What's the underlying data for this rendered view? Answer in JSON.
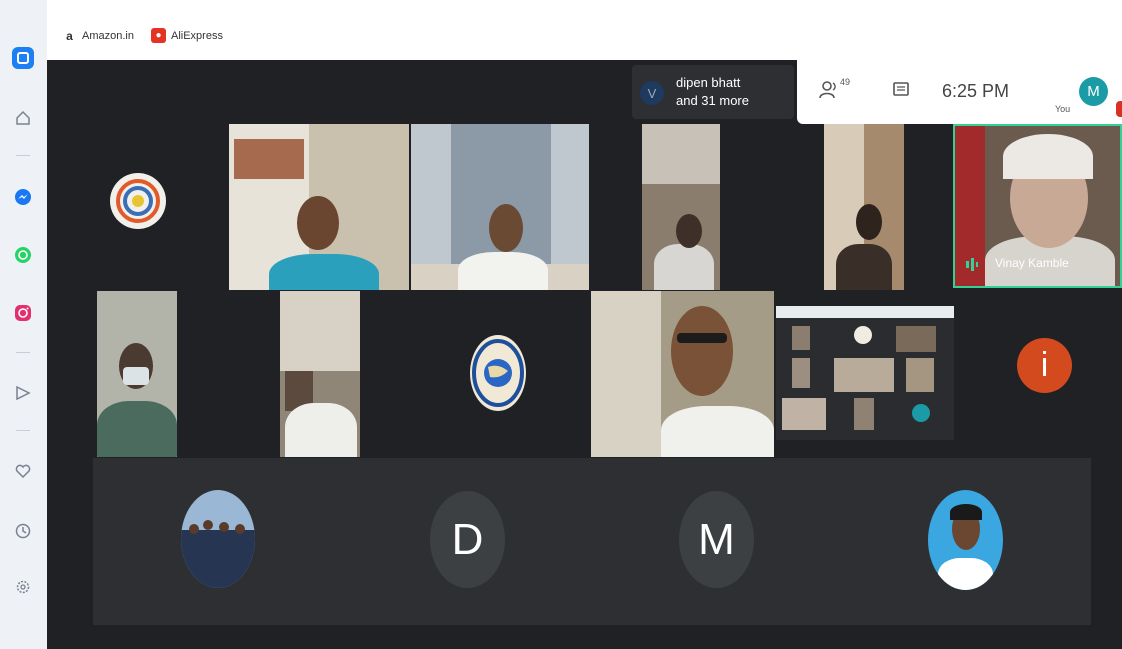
{
  "bookmarks": [
    {
      "label": "Amazon.in",
      "icon": "amazon-icon",
      "color": "#000000"
    },
    {
      "label": "AliExpress",
      "icon": "aliexpress-icon",
      "color": "#e43225"
    }
  ],
  "sidebar": {
    "items": [
      "browser-logo-icon",
      "home-icon",
      "messenger-icon",
      "whatsapp-icon",
      "instagram-icon",
      "send-icon",
      "heart-icon",
      "clock-icon",
      "settings-icon"
    ]
  },
  "meeting": {
    "speaker_notice": {
      "avatar_letter": "V",
      "line1": "dipen bhatt",
      "line2": "and 31 more"
    },
    "participant_count": "49",
    "time": "6:25 PM",
    "self_label": "You",
    "self_avatar_letter": "M",
    "active_speaker_name": "Vinay Kamble",
    "avatar_letters": [
      "D",
      "M"
    ],
    "info_letter": "i"
  },
  "colors": {
    "meet_bg": "#202124",
    "tile_bg": "#3c4043",
    "accent_teal": "#1a9ba6",
    "info_orange": "#d34a1e",
    "speaker_green": "#34d196"
  }
}
